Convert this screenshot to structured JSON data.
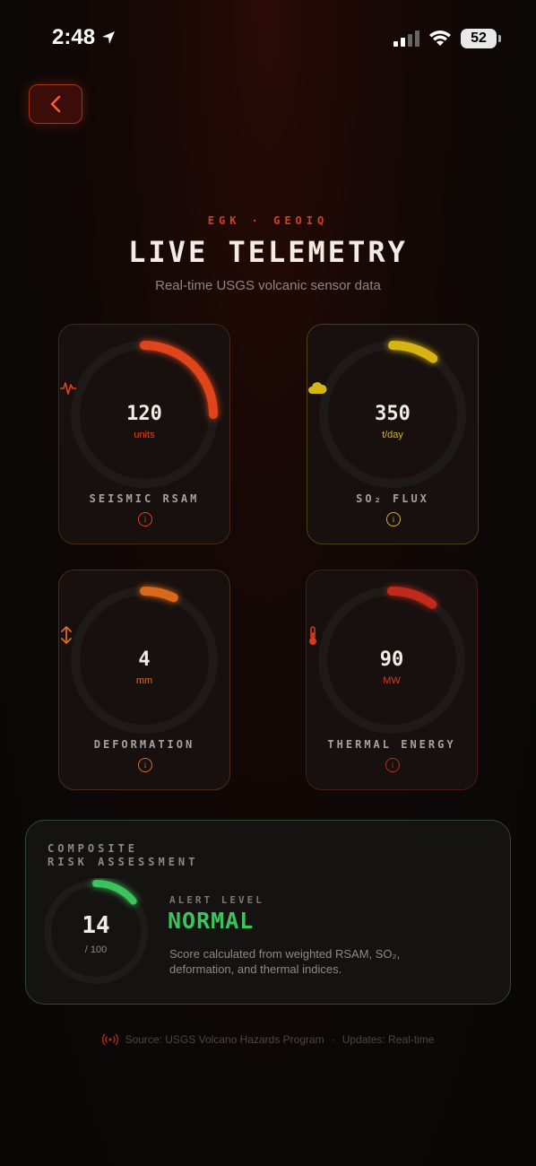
{
  "status_bar": {
    "time": "2:48",
    "battery": "52"
  },
  "header": {
    "kicker": "EGK · GEOIQ",
    "title": "LIVE TELEMETRY",
    "subtitle": "Real-time USGS volcanic sensor data"
  },
  "metrics": [
    {
      "value": "120",
      "unit": "units",
      "label": "SEISMIC RSAM",
      "icon": "seismic-wave-icon",
      "color": "#e0441a",
      "level": 0.25
    },
    {
      "value": "350",
      "unit": "t/day",
      "label": "SO₂ FLUX",
      "icon": "cloud-icon",
      "color": "#d6b413",
      "level": 0.1
    },
    {
      "value": "4",
      "unit": "mm",
      "label": "DEFORMATION",
      "icon": "vertical-arrows-icon",
      "color": "#d8681a",
      "level": 0.07
    },
    {
      "value": "90",
      "unit": "MW",
      "label": "THERMAL ENERGY",
      "icon": "thermometer-icon",
      "color": "#c02a1a",
      "level": 0.1
    }
  ],
  "risk": {
    "heading_line1": "COMPOSITE",
    "heading_line2": "RISK ASSESSMENT",
    "score": "14",
    "score_max": "/ 100",
    "score_level": 0.14,
    "alert_label": "ALERT LEVEL",
    "alert_value": "NORMAL",
    "description": "Score calculated from weighted RSAM, SO₂, deformation, and thermal indices.",
    "color": "#3cc45c"
  },
  "footer": {
    "source": "Source: USGS Volcano Hazards Program",
    "separator": "·",
    "updates": "Updates: Real-time"
  }
}
